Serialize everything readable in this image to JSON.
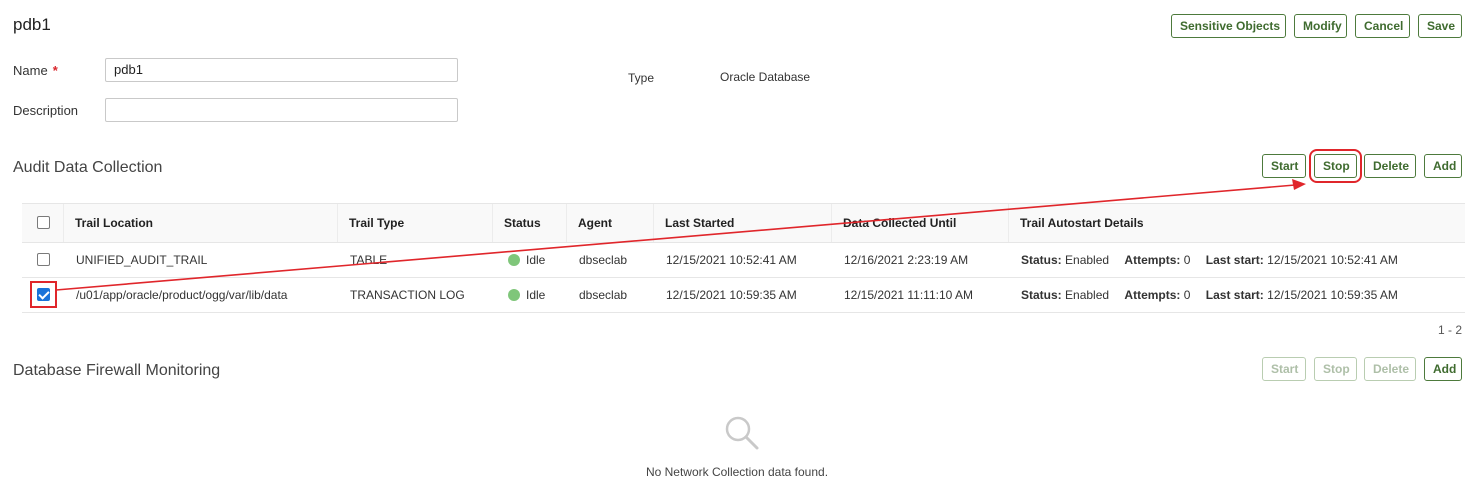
{
  "page": {
    "title": "pdb1"
  },
  "header_actions": {
    "sensitive_objects": "Sensitive Objects",
    "modify": "Modify",
    "cancel": "Cancel",
    "save": "Save"
  },
  "form": {
    "name_label": "Name",
    "required_mark": "*",
    "name_value": "pdb1",
    "description_label": "Description",
    "description_value": "",
    "type_label": "Type",
    "type_value": "Oracle Database"
  },
  "audit": {
    "title": "Audit Data Collection",
    "buttons": {
      "start": "Start",
      "stop": "Stop",
      "delete": "Delete",
      "add": "Add"
    },
    "columns": [
      "Trail Location",
      "Trail Type",
      "Status",
      "Agent",
      "Last Started",
      "Data Collected Until",
      "Trail Autostart Details"
    ],
    "rows": [
      {
        "checked": false,
        "trail_location": "UNIFIED_AUDIT_TRAIL",
        "trail_type": "TABLE",
        "status": "Idle",
        "agent": "dbseclab",
        "last_started": "12/15/2021 10:52:41 AM",
        "data_collected_until": "12/16/2021 2:23:19 AM",
        "autostart": {
          "status_label": "Status:",
          "status_value": "Enabled",
          "attempts_label": "Attempts:",
          "attempts_value": "0",
          "last_start_label": "Last start:",
          "last_start_value": "12/15/2021 10:52:41 AM"
        }
      },
      {
        "checked": true,
        "trail_location": "/u01/app/oracle/product/ogg/var/lib/data",
        "trail_type": "TRANSACTION LOG",
        "status": "Idle",
        "agent": "dbseclab",
        "last_started": "12/15/2021 10:59:35 AM",
        "data_collected_until": "12/15/2021 11:11:10 AM",
        "autostart": {
          "status_label": "Status:",
          "status_value": "Enabled",
          "attempts_label": "Attempts:",
          "attempts_value": "0",
          "last_start_label": "Last start:",
          "last_start_value": "12/15/2021 10:59:35 AM"
        }
      }
    ],
    "pagination": "1 - 2"
  },
  "firewall": {
    "title": "Database Firewall Monitoring",
    "buttons": {
      "start": "Start",
      "stop": "Stop",
      "delete": "Delete",
      "add": "Add"
    },
    "empty_message": "No Network Collection data found."
  },
  "icons": {
    "status_idle": "status-dot-icon",
    "empty": "search-icon",
    "annotation": "red-arrow-icon"
  },
  "colors": {
    "accent_button": "#3f6b2f",
    "highlight": "#e0262b",
    "checkbox_checked": "#1a73d9",
    "status_idle": "#7fc67a"
  }
}
